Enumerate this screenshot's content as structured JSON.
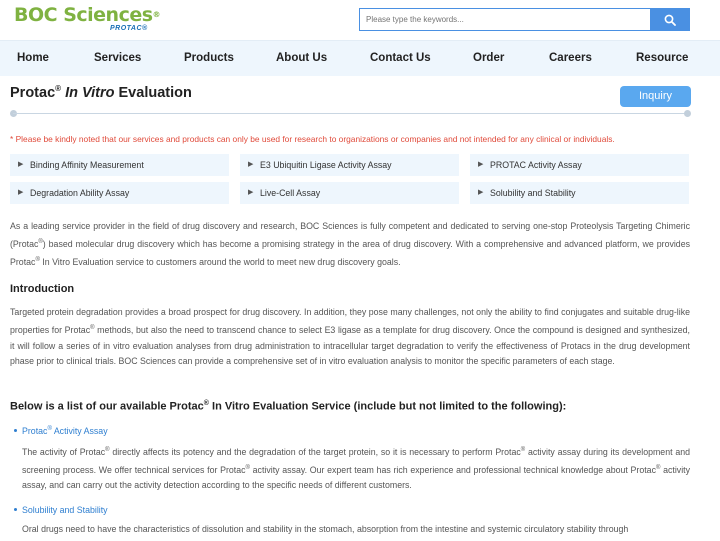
{
  "header": {
    "logo_main": "BOC Sciences",
    "logo_reg": "®",
    "logo_sub": "PROTAC®",
    "search_placeholder": "Please type the keywords...",
    "search_icon": "search-icon"
  },
  "nav": {
    "items": [
      "Home",
      "Services",
      "Products",
      "About Us",
      "Contact Us",
      "Order",
      "Careers",
      "Resource"
    ]
  },
  "page": {
    "title_a": "Protac",
    "title_sup": "®",
    "title_b": "In Vitro",
    "title_c": "Evaluation",
    "inquiry": "Inquiry",
    "notice": "* Please be kindly noted that our services and products can only be used for research to organizations or companies and not intended for any clinical or individuals."
  },
  "tabs": [
    "Binding Affinity Measurement",
    "E3 Ubiquitin Ligase Activity Assay",
    "PROTAC Activity Assay",
    "Degradation Ability Assay",
    "Live-Cell Assay",
    "Solubility and Stability"
  ],
  "intro_para": {
    "p1": "As a leading service provider in the field of drug discovery and research, BOC Sciences is fully competent and dedicated to serving one-stop Proteolysis Targeting Chimeric (Protac",
    "p2": ") based molecular drug discovery which has become a promising strategy in the area of drug discovery. With a comprehensive and advanced platform, we provides Protac",
    "p3": " In Vitro Evaluation service to customers around the world to meet new drug discovery goals."
  },
  "introduction": {
    "heading": "Introduction",
    "p1": "Targeted protein degradation provides a broad prospect for drug discovery. In addition, they pose many challenges, not only the ability to find conjugates and suitable drug-like properties for Protac",
    "p2": " methods, but also the need to transcend chance to select E3 ligase as a template for drug discovery. Once the compound is designed and synthesized, it will follow a series of in vitro evaluation analyses from drug administration to intracellular target degradation to verify the effectiveness of Protacs in the drug development phase prior to clinical trials. BOC Sciences can provide a comprehensive set of in vitro evaluation analysis to monitor the specific parameters of each stage."
  },
  "services": {
    "heading_a": "Below is a list of our available Protac",
    "heading_b": " In Vitro Evaluation Service (include but not limited to the following):",
    "item1_a": "Protac",
    "item1_b": " Activity Assay",
    "item1_p1": "The activity of Protac",
    "item1_p2": " directly affects its potency and the degradation of the target protein, so it is necessary to perform Protac",
    "item1_p3": " activity assay during its development and screening process. We offer technical services for Protac",
    "item1_p4": " activity assay. Our expert team has rich experience and professional technical knowledge about Protac",
    "item1_p5": " activity assay, and can carry out the activity detection according to the specific needs of different customers.",
    "item2": "Solubility and Stability",
    "item2_p": "Oral drugs need to have the characteristics of dissolution and stability in the stomach, absorption from the intestine and systemic circulatory stability through"
  },
  "reg": "®",
  "colors": {
    "accent": "#4a90e2",
    "brand_green": "#7fb241",
    "notice_red": "#e04a3a",
    "link": "#2f7fd0"
  }
}
